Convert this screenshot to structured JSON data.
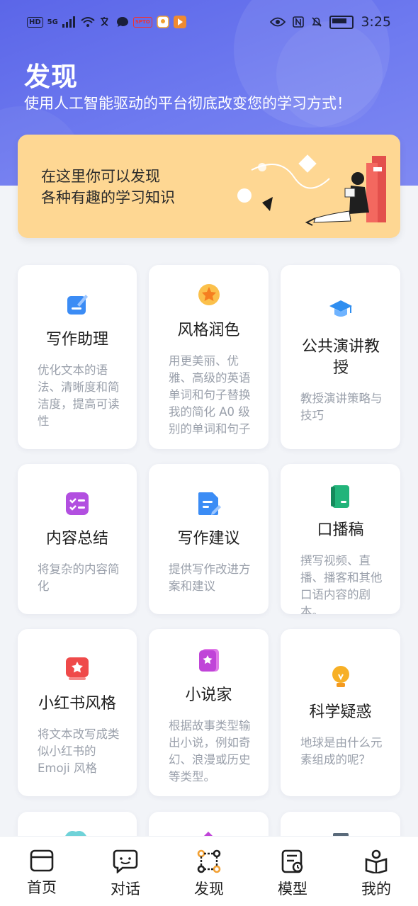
{
  "status_bar": {
    "hd": "HD",
    "signal": "5G",
    "time": "3:25",
    "app_badge": "SPTO"
  },
  "header": {
    "title": "发现",
    "subtitle": "使用人工智能驱动的平台彻底改变您的学习方式！"
  },
  "banner": {
    "line1": "在这里你可以发现",
    "line2": "各种有趣的学习知识"
  },
  "cards": [
    {
      "title": "写作助理",
      "desc": "优化文本的语法、清晰度和简洁度，提高可读性",
      "icon": "edit-doc-icon",
      "color": "#3b8cf5"
    },
    {
      "title": "风格润色",
      "desc": "用更美丽、优雅、高级的英语单词和句子替换我的简化 A0 级别的单词和句子",
      "icon": "star-badge-icon",
      "color": "#f7a02a"
    },
    {
      "title": "公共演讲教授",
      "desc": "教授演讲策略与技巧",
      "icon": "graduation-cap-icon",
      "color": "#2f8ef0"
    },
    {
      "title": "内容总结",
      "desc": "将复杂的内容简化",
      "icon": "checklist-icon",
      "color": "#b24fe0"
    },
    {
      "title": "写作建议",
      "desc": "提供写作改进方案和建议",
      "icon": "pen-doc-icon",
      "color": "#3b8cf5"
    },
    {
      "title": "口播稿",
      "desc": "撰写视频、直播、播客和其他口语内容的剧本。",
      "icon": "book-icon",
      "color": "#22b47a"
    },
    {
      "title": "小红书风格",
      "desc": "将文本改写成类似小红书的 Emoji 风格",
      "icon": "red-star-icon",
      "color": "#ef4a4a"
    },
    {
      "title": "小说家",
      "desc": "根据故事类型输出小说，例如奇幻、浪漫或历史等类型。",
      "icon": "novel-icon",
      "color": "#c044d8"
    },
    {
      "title": "科学疑惑",
      "desc": "地球是由什么元素组成的呢？",
      "icon": "lightbulb-icon",
      "color": "#f49a1f"
    }
  ],
  "nav": {
    "items": [
      {
        "label": "首页",
        "icon": "browser-window-icon"
      },
      {
        "label": "对话",
        "icon": "chat-face-icon"
      },
      {
        "label": "发现",
        "icon": "discover-nodes-icon"
      },
      {
        "label": "模型",
        "icon": "model-book-icon"
      },
      {
        "label": "我的",
        "icon": "profile-book-icon"
      }
    ],
    "active_color": "#f2a033"
  }
}
